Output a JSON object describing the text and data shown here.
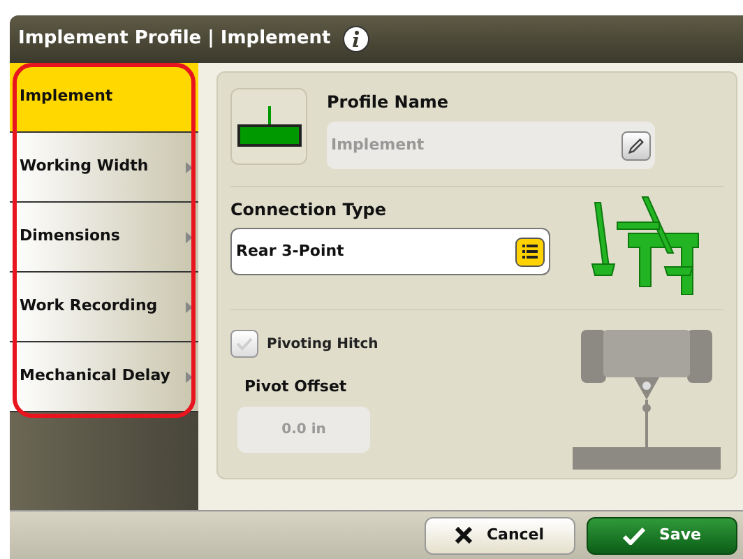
{
  "window": {
    "title": "Implement Profile | Implement"
  },
  "sidebar": {
    "highlighted": true,
    "items": [
      {
        "label": "Implement",
        "selected": true
      },
      {
        "label": "Working Width",
        "selected": false
      },
      {
        "label": "Dimensions",
        "selected": false
      },
      {
        "label": "Work Recording",
        "selected": false
      },
      {
        "label": "Mechanical Delay",
        "selected": false
      }
    ]
  },
  "profile_name": {
    "label": "Profile Name",
    "value": "Implement"
  },
  "connection_type": {
    "label": "Connection Type",
    "value": "Rear 3-Point"
  },
  "pivoting_hitch": {
    "label": "Pivoting Hitch",
    "checked": false
  },
  "pivot_offset": {
    "label": "Pivot Offset",
    "value": "0.0 in"
  },
  "buttons": [
    {
      "kind": "cancel",
      "label": "Cancel"
    },
    {
      "kind": "save",
      "label": "Save"
    }
  ]
}
